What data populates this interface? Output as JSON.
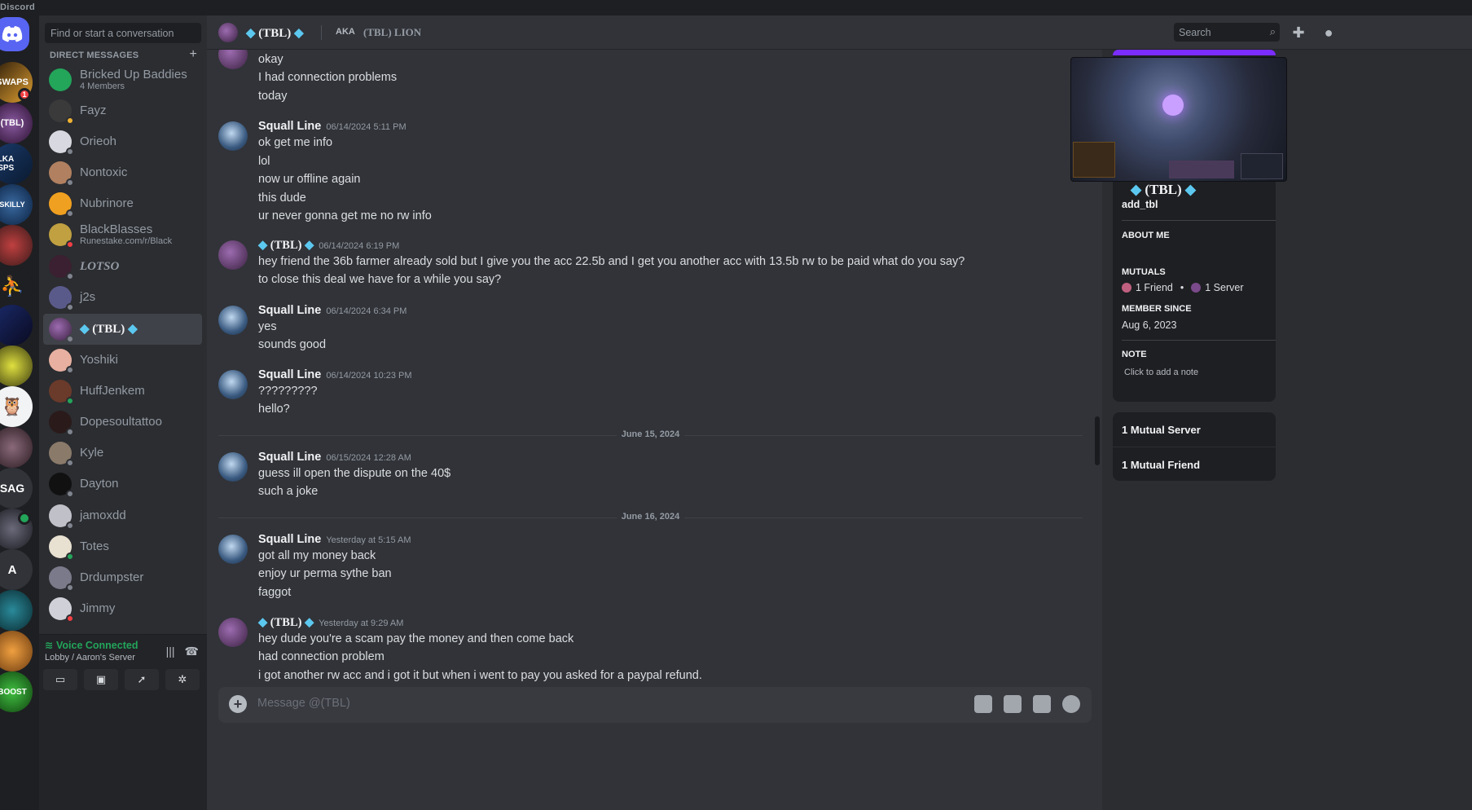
{
  "app": {
    "brand": "Discord"
  },
  "sidebar": {
    "search_placeholder": "Find or start a conversation",
    "direct_messages_label": "DIRECT MESSAGES",
    "add_dm_label": "+",
    "dms": [
      {
        "name": "Bricked Up Baddies",
        "sub": "4 Members"
      },
      {
        "name": "Fayz",
        "sub": ""
      },
      {
        "name": "Orieoh",
        "sub": ""
      },
      {
        "name": "Nontoxic",
        "sub": ""
      },
      {
        "name": "Nubrinore",
        "sub": ""
      },
      {
        "name": "BlackBlasses",
        "sub": "Runestake.com/r/Black"
      },
      {
        "name": "LOTSO",
        "sub": ""
      },
      {
        "name": "j2s",
        "sub": ""
      },
      {
        "name": "(TBL)",
        "sub": ""
      },
      {
        "name": "Yoshiki",
        "sub": ""
      },
      {
        "name": "HuffJenkem",
        "sub": ""
      },
      {
        "name": "Dopesoultattoo",
        "sub": ""
      },
      {
        "name": "Kyle",
        "sub": ""
      },
      {
        "name": "Dayton",
        "sub": ""
      },
      {
        "name": "jamoxdd",
        "sub": ""
      },
      {
        "name": "Totes",
        "sub": ""
      },
      {
        "name": "Drdumpster",
        "sub": ""
      },
      {
        "name": "Jimmy",
        "sub": ""
      }
    ]
  },
  "servers": {
    "unread_badge": "1",
    "labels": [
      "SWAPS",
      "(TBL)",
      "ELKA RSPS",
      "SKILLY",
      "SAG",
      "A",
      "BOOST"
    ]
  },
  "voice": {
    "status": "Voice Connected",
    "channel": "Lobby / Aaron's Server"
  },
  "header": {
    "name": "(TBL)",
    "aka_label": "AKA",
    "aka_name": "(TBL) LION",
    "search_placeholder": "Search"
  },
  "messages": {
    "top_lines": [
      "okay",
      "I had connection problems",
      "today"
    ],
    "m1": {
      "author": "Squall Line",
      "time": "06/14/2024 5:11 PM",
      "lines": [
        "ok get me info",
        "lol",
        "now ur offline again",
        "this dude",
        "ur never gonna get me no rw info"
      ]
    },
    "m2": {
      "author": "(TBL)",
      "time": "06/14/2024 6:19 PM",
      "lines": [
        "hey friend the 36b farmer already sold but I give you the acc 22.5b and I get you another acc with 13.5b rw to be paid what do you say?",
        "to close this deal we have for a while you say?"
      ]
    },
    "m3": {
      "author": "Squall Line",
      "time": "06/14/2024 6:34 PM",
      "lines": [
        "yes",
        "sounds good"
      ]
    },
    "m4": {
      "author": "Squall Line",
      "time": "06/14/2024 10:23 PM",
      "lines": [
        "?????????",
        "hello?"
      ]
    },
    "divider1": "June 15, 2024",
    "m5": {
      "author": "Squall Line",
      "time": "06/15/2024 12:28 AM",
      "lines": [
        "guess ill open the dispute on the 40$",
        "such a joke"
      ]
    },
    "divider2": "June 16, 2024",
    "m6": {
      "author": "Squall Line",
      "time": "Yesterday at 5:15 AM",
      "lines": [
        "got all my money back",
        "enjoy ur perma sythe ban",
        "faggot"
      ]
    },
    "m7": {
      "author": "(TBL)",
      "time": "Yesterday at 9:29 AM",
      "lines": [
        "hey dude you're a scam pay the money and then come back",
        "had connection problem",
        "i got another rw acc and i got it but when i went to pay you asked for a paypal refund."
      ]
    }
  },
  "composer": {
    "placeholder": "Message @(TBL)"
  },
  "profile": {
    "display_name": "(TBL)",
    "username": "add_tbl",
    "about_label": "ABOUT ME",
    "mutuals_label": "MUTUALS",
    "mutual_friends": "1 Friend",
    "mutual_servers": "1 Server",
    "member_since_label": "MEMBER SINCE",
    "member_since": "Aug 6, 2023",
    "note_label": "NOTE",
    "note_placeholder": "Click to add a note",
    "mutual_server_card": "1 Mutual Server",
    "mutual_friend_card": "1 Mutual Friend"
  },
  "colors": {
    "accent": "#5865f2",
    "online": "#23a55a",
    "dnd": "#f23f43",
    "idle": "#f0b232",
    "banner": "#7b2cff"
  }
}
